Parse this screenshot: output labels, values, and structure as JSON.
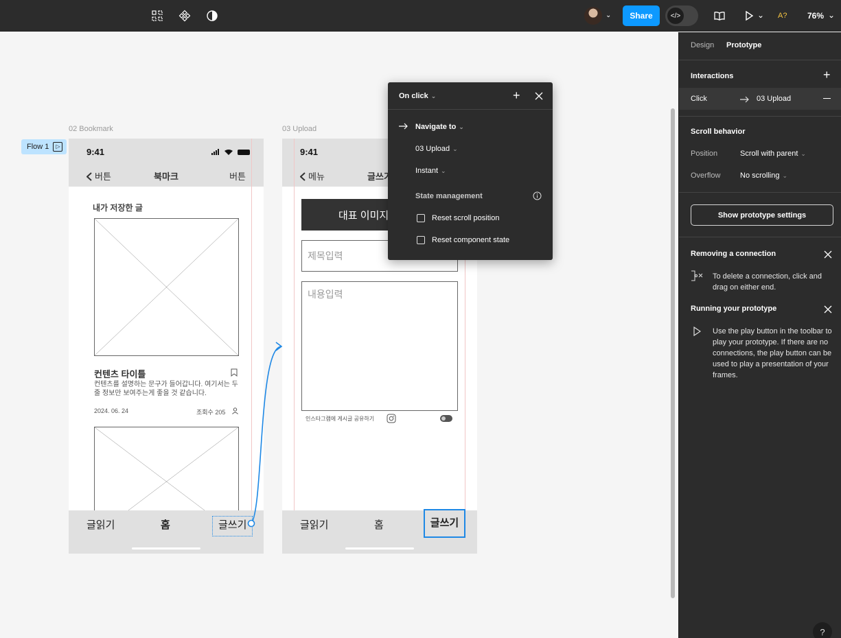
{
  "toolbar": {
    "share_label": "Share",
    "zoom": "76%",
    "a_label": "A?",
    "devmode_icon": "</>"
  },
  "canvas": {
    "flow_label": "Flow 1",
    "frames": [
      {
        "label": "02 Bookmark",
        "time": "9:41",
        "nav_back": "버튼",
        "nav_title": "북마크",
        "nav_right": "버튼",
        "section_title": "내가 저장한 글",
        "card_title": "컨텐츠 타이틀",
        "card_desc": "컨텐츠를 설명하는 문구가 들어갑니다. 여기서는 두 줄 정보만 보여주는게 좋을 것 같습니다.",
        "card_date": "2024. 06. 24",
        "card_views": "조회수 205",
        "tabs": [
          "글읽기",
          "홈",
          "글쓰기"
        ]
      },
      {
        "label": "03 Upload",
        "time": "9:41",
        "nav_back": "메뉴",
        "nav_title": "글쓰기",
        "image_button": "대표 이미지",
        "title_placeholder": "제목입력",
        "content_placeholder": "내용입력",
        "share_instagram": "인스타그램에 게시글 공유하기",
        "tabs": [
          "글읽기",
          "홈",
          "글쓰기"
        ]
      }
    ]
  },
  "popover": {
    "trigger": "On click",
    "action": "Navigate to",
    "destination": "03 Upload",
    "animation": "Instant",
    "state_title": "State management",
    "reset_scroll": "Reset scroll position",
    "reset_component": "Reset component state"
  },
  "panel": {
    "tabs": [
      "Design",
      "Prototype"
    ],
    "interactions_title": "Interactions",
    "interaction": {
      "trigger": "Click",
      "target": "03 Upload"
    },
    "scroll_title": "Scroll behavior",
    "position_label": "Position",
    "position_value": "Scroll with parent",
    "overflow_label": "Overflow",
    "overflow_value": "No scrolling",
    "proto_settings_button": "Show prototype settings",
    "removing_title": "Removing a connection",
    "removing_body": "To delete a connection, click and drag on either end.",
    "running_title": "Running your prototype",
    "running_body": "Use the play button in the toolbar to play your prototype. If there are no connections, the play button can be used to play a presentation of your frames.",
    "help": "?"
  },
  "colors": {
    "accent": "#0d99ff",
    "panel_bg": "#2c2c2c",
    "canvas_bg": "#f5f5f5",
    "connector": "#1e88e5"
  }
}
